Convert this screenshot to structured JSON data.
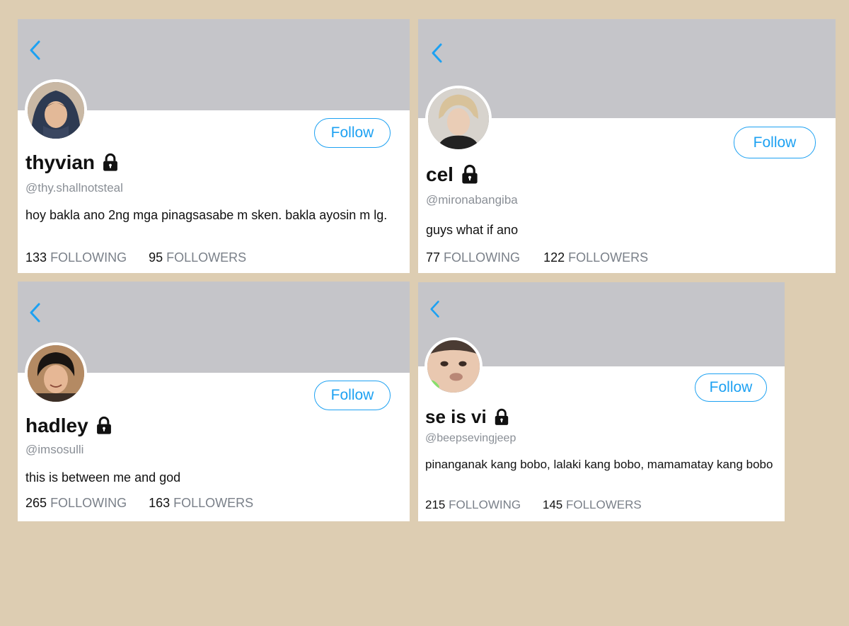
{
  "profiles": [
    {
      "name": "thyvian",
      "handle": "@thy.shallnotsteal",
      "bio": "hoy bakla ano 2ng mga pinagsasabe m sken. bakla ayosin m lg.",
      "following_count": "133",
      "followers_count": "95",
      "follow_label": "Follow",
      "following_label": "FOLLOWING",
      "followers_label": "FOLLOWERS",
      "icons": [
        "back-chevron-icon",
        "lock-icon"
      ]
    },
    {
      "name": "cel",
      "handle": "@mironabangiba",
      "bio": "guys what if ano",
      "following_count": "77",
      "followers_count": "122",
      "follow_label": "Follow",
      "following_label": "FOLLOWING",
      "followers_label": "FOLLOWERS",
      "icons": [
        "back-chevron-icon",
        "lock-icon"
      ]
    },
    {
      "name": "hadley",
      "handle": "@imsosulli",
      "bio": "this is between me and god",
      "following_count": "265",
      "followers_count": "163",
      "follow_label": "Follow",
      "following_label": "FOLLOWING",
      "followers_label": "FOLLOWERS",
      "icons": [
        "back-chevron-icon",
        "lock-icon"
      ]
    },
    {
      "name": "se is vi",
      "handle": "@beepsevingjeep",
      "bio": "pinanganak kang bobo, lalaki kang bobo, mamamatay kang bobo",
      "following_count": "215",
      "followers_count": "145",
      "follow_label": "Follow",
      "following_label": "FOLLOWING",
      "followers_label": "FOLLOWERS",
      "icons": [
        "back-chevron-icon",
        "lock-icon"
      ]
    }
  ],
  "colors": {
    "page_background": "#ddcdb2",
    "banner": "#c5c5c9",
    "accent": "#1da1f2",
    "muted_text": "#7a8089"
  }
}
